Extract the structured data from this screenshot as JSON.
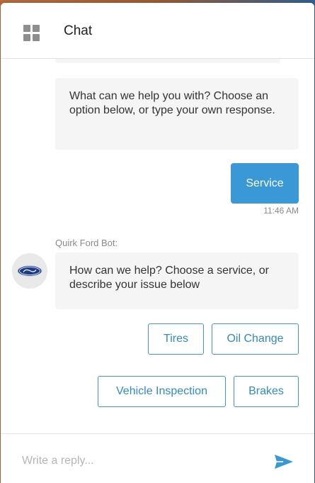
{
  "header": {
    "title": "Chat"
  },
  "messages": {
    "bot_prompt_1": "What can we help you with? Choose an option below, or type your own response.",
    "user_reply": "Service",
    "user_reply_time": "11:46 AM",
    "bot_sender": "Quirk Ford Bot:",
    "bot_prompt_2": "How can we help? Choose a service, or describe your issue below"
  },
  "options": [
    "Tires",
    "Oil Change",
    "Vehicle Inspection",
    "Brakes"
  ],
  "composer": {
    "placeholder": "Write a reply..."
  },
  "avatar": {
    "brand_text": "Ford",
    "icon": "ford-logo-icon"
  },
  "icons": {
    "menu": "grid-icon",
    "send": "send-icon"
  },
  "colors": {
    "accent": "#3a98d6",
    "bubble_bg": "#f5f5f5",
    "ford_blue": "#1b3a8a"
  }
}
